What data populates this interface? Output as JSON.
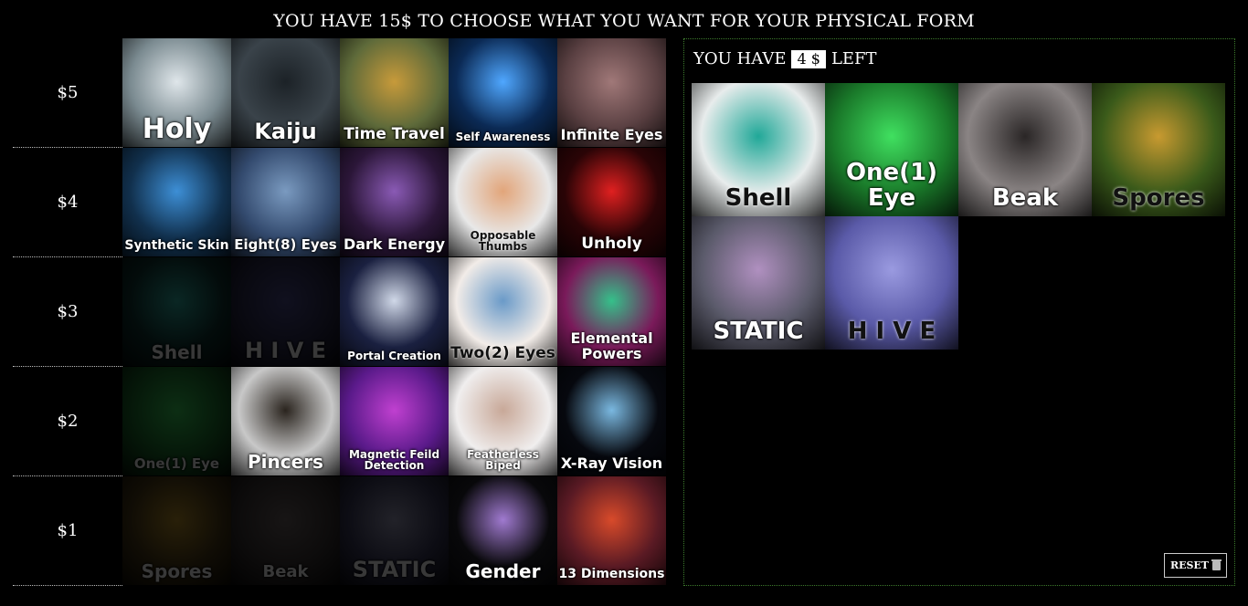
{
  "header": {
    "title": "YOU HAVE 15$ TO CHOOSE WHAT YOU WANT FOR YOUR PHYSICAL FORM"
  },
  "budget": {
    "prefix": "YOU HAVE",
    "amount": "4 $",
    "suffix": "LEFT"
  },
  "reset_label": "RESET",
  "tiers": [
    {
      "price": "$5",
      "items": [
        {
          "label": "Holy",
          "bg": "#7a8a90",
          "fg": "#dfe6ea",
          "size": 30
        },
        {
          "label": "Kaiju",
          "bg": "#3a434a",
          "fg": "#1c2227",
          "size": 24
        },
        {
          "label": "Time Travel",
          "bg": "#5e6a3a",
          "fg": "#c79a3a",
          "size": 17
        },
        {
          "label": "Self Awareness",
          "bg": "#0b2a55",
          "fg": "#4fa7ff",
          "size": 12
        },
        {
          "label": "Infinite Eyes",
          "bg": "#5a4042",
          "fg": "#a07878",
          "size": 16
        }
      ]
    },
    {
      "price": "$4",
      "items": [
        {
          "label": "Synthetic Skin",
          "bg": "#11304d",
          "fg": "#3d8fd6",
          "size": 14
        },
        {
          "label": "Eight(8) Eyes",
          "bg": "#334a6e",
          "fg": "#7a9ac0",
          "size": 15
        },
        {
          "label": "Dark Energy",
          "bg": "#2b1638",
          "fg": "#8a5ab5",
          "size": 16
        },
        {
          "label": "Opposable Thumbs",
          "bg": "#e8e8e8",
          "fg": "#e2a57a",
          "size": 12,
          "dark": true
        },
        {
          "label": "Unholy",
          "bg": "#2a0406",
          "fg": "#e02020",
          "size": 17
        }
      ]
    },
    {
      "price": "$3",
      "items": [
        {
          "label": "Shell",
          "bg": "#0f3532",
          "fg": "#2fb0a3",
          "size": 20,
          "dim": true
        },
        {
          "label": "H I V E",
          "bg": "#2a2a4a",
          "fg": "#4a4a8a",
          "size": 24,
          "dim": true
        },
        {
          "label": "Portal Creation",
          "bg": "#1a2040",
          "fg": "#d0d8e8",
          "size": 12
        },
        {
          "label": "Two(2) Eyes",
          "bg": "#f2ece8",
          "fg": "#6a9ac8",
          "size": 17,
          "dark": true
        },
        {
          "label": "Elemental Powers",
          "bg": "#7a1a5a",
          "fg": "#35c08a",
          "size": 16
        }
      ]
    },
    {
      "price": "$2",
      "items": [
        {
          "label": "One(1) Eye",
          "bg": "#1a6a2a",
          "fg": "#3ad05a",
          "size": 15,
          "dim": true
        },
        {
          "label": "Pincers",
          "bg": "#c8c8c8",
          "fg": "#2a241e",
          "size": 20
        },
        {
          "label": "Magnetic Feild Detection",
          "bg": "#5a1a8a",
          "fg": "#c040d0",
          "size": 12
        },
        {
          "label": "Featherless Biped",
          "bg": "#f0eeee",
          "fg": "#c8a898",
          "size": 12
        },
        {
          "label": "X-Ray Vision",
          "bg": "#06080e",
          "fg": "#7ab8e0",
          "size": 16
        }
      ]
    },
    {
      "price": "$1",
      "items": [
        {
          "label": "Spores",
          "bg": "#4a3a18",
          "fg": "#b8902a",
          "size": 20,
          "dim": true
        },
        {
          "label": "Beak",
          "bg": "#3a3434",
          "fg": "#6a6060",
          "size": 18,
          "dim": true
        },
        {
          "label": "STATIC",
          "bg": "#3a3a5a",
          "fg": "#9a9ab8",
          "size": 24,
          "dim": true
        },
        {
          "label": "Gender",
          "bg": "#08080a",
          "fg": "#a07ad0",
          "size": 20
        },
        {
          "label": "13 Dimensions",
          "bg": "#5a1a24",
          "fg": "#d84a2a",
          "size": 14
        }
      ]
    }
  ],
  "chosen": [
    {
      "label": "Shell",
      "bg": "#e8ecec",
      "fg": "#20a898",
      "dark": true
    },
    {
      "label": "One(1) Eye",
      "bg": "#1a7a2a",
      "fg": "#40e060"
    },
    {
      "label": "Beak",
      "bg": "#8a8484",
      "fg": "#2a2626"
    },
    {
      "label": "Spores",
      "bg": "#3a5a1a",
      "fg": "#c89a30",
      "dark": true
    },
    {
      "label": "STATIC",
      "bg": "#5a5a6a",
      "fg": "#b090c0"
    },
    {
      "label": "H I V E",
      "bg": "#5a5aa8",
      "fg": "#9a9ae0",
      "dark": true
    }
  ]
}
